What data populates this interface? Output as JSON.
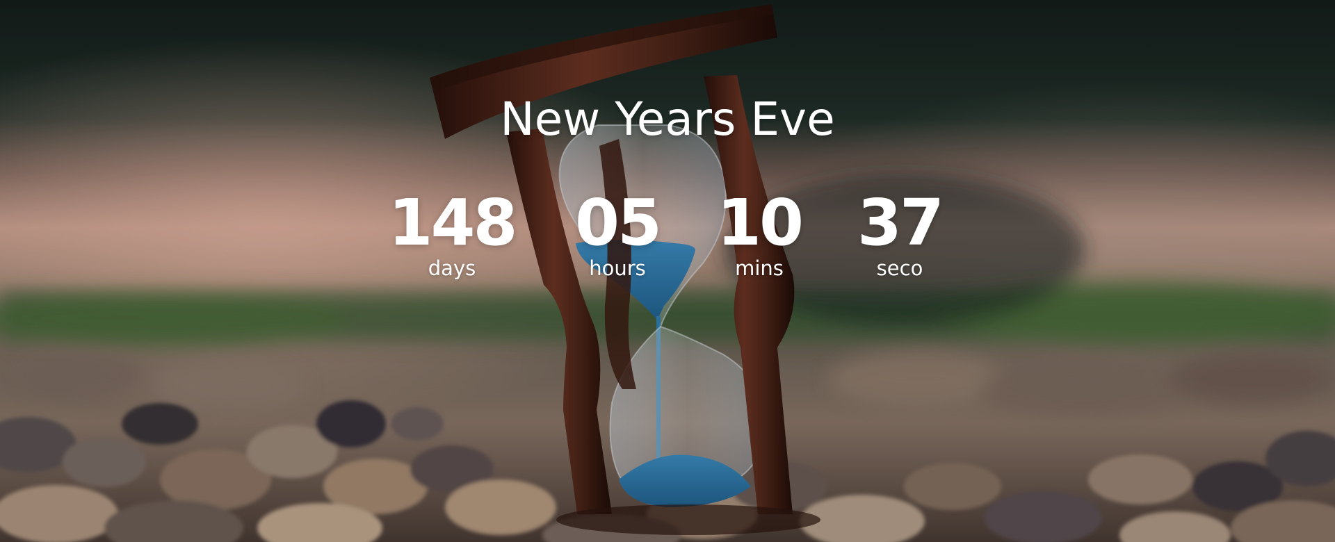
{
  "countdown": {
    "title": "New Years Eve",
    "units": [
      {
        "value": "148",
        "label": "days"
      },
      {
        "value": "05",
        "label": "hours"
      },
      {
        "value": "10",
        "label": "mins"
      },
      {
        "value": "37",
        "label": "seco"
      }
    ]
  },
  "background": {
    "subject": "hourglass-on-pebbles-photo",
    "sand_color": "#2f7fb0",
    "wood_color": "#4a2418",
    "sky_color": "#1c2a25"
  }
}
